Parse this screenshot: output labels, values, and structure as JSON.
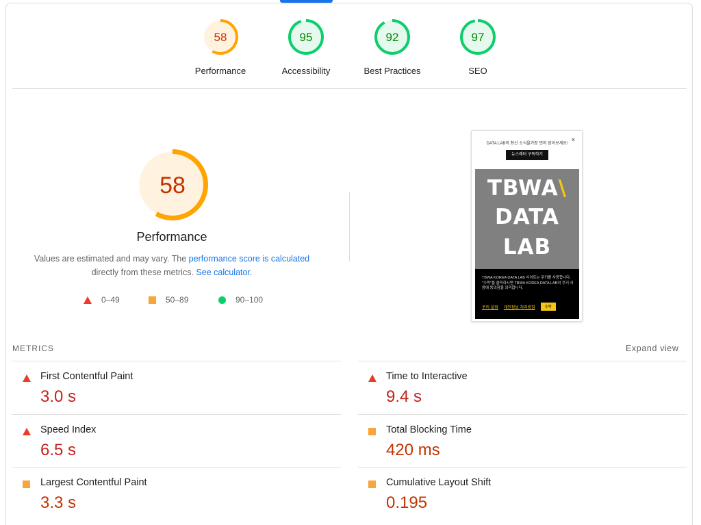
{
  "gauges": [
    {
      "score": "58",
      "label": "Performance",
      "value": 0.58,
      "rating": "average"
    },
    {
      "score": "95",
      "label": "Accessibility",
      "value": 0.95,
      "rating": "pass"
    },
    {
      "score": "92",
      "label": "Best Practices",
      "value": 0.92,
      "rating": "pass"
    },
    {
      "score": "97",
      "label": "SEO",
      "value": 0.97,
      "rating": "pass"
    }
  ],
  "performance": {
    "score": "58",
    "value": 0.58,
    "title": "Performance",
    "desc_prefix": "Values are estimated and may vary. The ",
    "desc_link": "performance score is calculated",
    "desc_mid": " directly from these metrics. ",
    "calc_link": "See calculator.",
    "legend": [
      {
        "shape": "triangle-icon",
        "range": "0–49"
      },
      {
        "shape": "square-icon",
        "range": "50–89"
      },
      {
        "shape": "circle-icon",
        "range": "90–100"
      }
    ]
  },
  "screenshot": {
    "popup_text": "DATA LAB의 최신 소식을가장 먼저 받아보세요!",
    "close": "×",
    "subscribe": "뉴스레터 구독하기",
    "hero_lines": [
      "TBWA",
      "DATA",
      "LAB"
    ],
    "hero_slash": "\\",
    "cookie_text": "TBWA KOREA DATA LAB 사이트는 쿠키를 사용합니다. \"수락\"을 클릭하시면 TBWA KOREA DATA LAB의 쿠키 사용에 동의함을 의미합니다.",
    "cookie_settings": "쿠키 설정",
    "privacy": "개인정보 처리방침",
    "accept": "수락"
  },
  "metrics": {
    "heading": "METRICS",
    "expand": "Expand view",
    "items": [
      {
        "name": "First Contentful Paint",
        "value": "3.0 s",
        "rating": "fail"
      },
      {
        "name": "Time to Interactive",
        "value": "9.4 s",
        "rating": "fail"
      },
      {
        "name": "Speed Index",
        "value": "6.5 s",
        "rating": "fail"
      },
      {
        "name": "Total Blocking Time",
        "value": "420 ms",
        "rating": "average"
      },
      {
        "name": "Largest Contentful Paint",
        "value": "3.3 s",
        "rating": "average"
      },
      {
        "name": "Cumulative Layout Shift",
        "value": "0.195",
        "rating": "average"
      }
    ]
  },
  "colors": {
    "pass": "#0cce6b",
    "average": "#ffa400",
    "fail": "#ff4e42",
    "link": "#1a73e8"
  }
}
